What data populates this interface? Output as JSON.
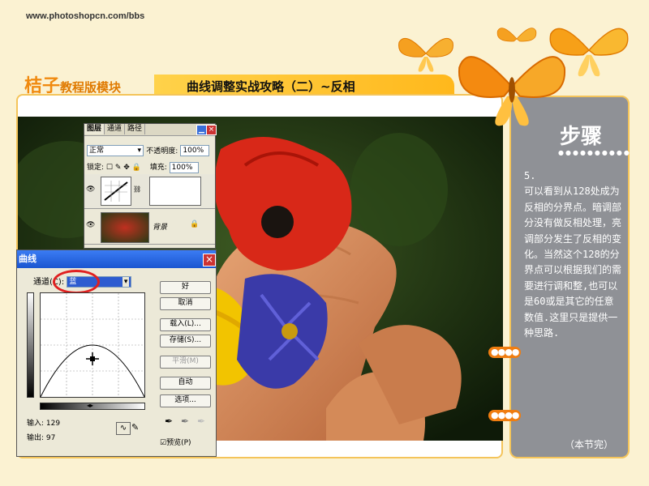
{
  "header": {
    "site_url": "www.photoshopcn.com/bbs",
    "brand_main": "桔子",
    "brand_sub": "教程版模块",
    "page_title": "曲线调整实战攻略（二）~反相"
  },
  "side_panel": {
    "heading": "步骤",
    "dots": "●●●●●●●●●●",
    "body": "5.\n可以看到从128处成为反相的分界点。暗调部分没有做反相处理，亮调部分发生了反相的变化。当然这个128的分界点可以根据我们的需要进行调和整,也可以是60或是其它的任意数值.这里只是提供一种思路.",
    "end_note": "（本节完）",
    "orange_dots": "●●●●"
  },
  "layers_panel": {
    "tabs": [
      "图层",
      "通道",
      "路径"
    ],
    "blend_mode": "正常",
    "opacity_label": "不透明度:",
    "opacity_value": "100%",
    "lock_label": "锁定:",
    "fill_label": "填充:",
    "fill_value": "100%",
    "layers": [
      {
        "name": ""
      },
      {
        "name": "背景"
      }
    ]
  },
  "curves_dialog": {
    "title": "曲线",
    "channel_label": "通道(C):",
    "channel_value": "蓝",
    "input_label": "输入:",
    "input_value": "129",
    "output_label": "输出:",
    "output_value": "97",
    "preview_label": "预览(P)",
    "buttons": {
      "ok": "好",
      "cancel": "取消",
      "load": "载入(L)...",
      "save": "存储(S)...",
      "smooth": "平滑(M)",
      "auto": "自动",
      "options": "选项..."
    }
  },
  "colors": {
    "accent_orange": "#f08a10",
    "panel_gray": "#8f9196",
    "frame_border": "#f4c45a",
    "highlight_red": "#e02020"
  }
}
